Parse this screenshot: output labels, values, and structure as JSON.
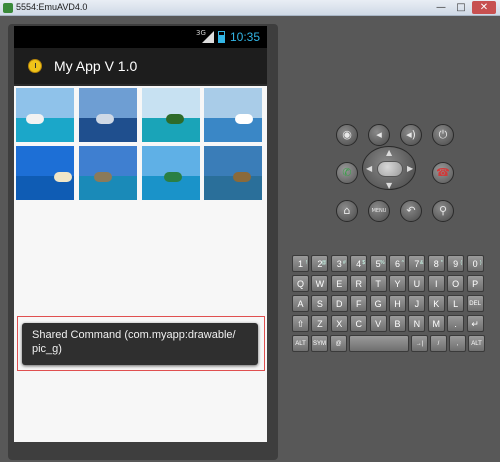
{
  "window": {
    "title": "5554:EmuAVD4.0",
    "min_label": "—",
    "max_label": "□",
    "close_label": "✕"
  },
  "statusbar": {
    "network": "3G",
    "time": "10:35"
  },
  "actionbar": {
    "app_icon": "clock-icon",
    "title": "My App V 1.0"
  },
  "gallery": {
    "items": [
      {
        "name": "pic_a",
        "sky": "#8fc2ea",
        "sea": "#1ba7c9",
        "extra": "#f2f2f2"
      },
      {
        "name": "pic_b",
        "sky": "#6e9ed3",
        "sea": "#1f4f8e",
        "extra": "#cfd9e6"
      },
      {
        "name": "pic_c",
        "sky": "#c7e1f2",
        "sea": "#1aa4b8",
        "extra": "#2e6b2a"
      },
      {
        "name": "pic_d",
        "sky": "#a9cce8",
        "sea": "#3a87c6",
        "extra": "#ffffff"
      },
      {
        "name": "pic_e",
        "sky": "#1d6fd6",
        "sea": "#0f5cb4",
        "extra": "#f0e6c8"
      },
      {
        "name": "pic_f",
        "sky": "#3f7fd0",
        "sea": "#1a8ab8",
        "extra": "#8a7a5a"
      },
      {
        "name": "pic_g",
        "sky": "#5fb0e6",
        "sea": "#1a93c9",
        "extra": "#2a7f44"
      },
      {
        "name": "pic_h",
        "sky": "#3a7db8",
        "sea": "#2a6f9a",
        "extra": "#8a6a3a"
      }
    ]
  },
  "toast": {
    "text": "Shared Command (com.myapp:drawable/ pic_g)"
  },
  "hardware": {
    "buttons": [
      {
        "name": "camera",
        "icon": "camera-icon",
        "glyph": "◉"
      },
      {
        "name": "volume-down",
        "icon": "volume-down-icon",
        "glyph": "◂"
      },
      {
        "name": "volume-up",
        "icon": "volume-up-icon",
        "glyph": "◂)"
      },
      {
        "name": "power",
        "icon": "power-icon",
        "glyph": "⏻"
      },
      {
        "name": "call",
        "icon": "call-icon",
        "glyph": "✆"
      },
      {
        "name": "end-call",
        "icon": "end-call-icon",
        "glyph": "☎"
      },
      {
        "name": "home",
        "icon": "home-icon",
        "glyph": "⌂"
      },
      {
        "name": "menu",
        "icon": "menu-icon",
        "glyph": "MENU"
      },
      {
        "name": "back",
        "icon": "back-icon",
        "glyph": "↶"
      },
      {
        "name": "search",
        "icon": "search-icon",
        "glyph": "⚲"
      }
    ],
    "call_color": "#3aa04a",
    "end_call_color": "#d03a3a"
  },
  "keyboard": {
    "row1": [
      "1",
      "2",
      "3",
      "4",
      "5",
      "6",
      "7",
      "8",
      "9",
      "0"
    ],
    "row1_alt": [
      "!",
      "@",
      "#",
      "$",
      "%",
      "^",
      "&",
      "*",
      "(",
      ")"
    ],
    "row2": [
      "Q",
      "W",
      "E",
      "R",
      "T",
      "Y",
      "U",
      "I",
      "O",
      "P"
    ],
    "row3": [
      "A",
      "S",
      "D",
      "F",
      "G",
      "H",
      "J",
      "K",
      "L",
      "DEL"
    ],
    "row4": [
      "⇧",
      "Z",
      "X",
      "C",
      "V",
      "B",
      "N",
      "M",
      ".",
      "↵"
    ],
    "row5": [
      "ALT",
      "SYM",
      "@",
      "",
      "→|",
      "/",
      ",",
      "ALT"
    ]
  }
}
